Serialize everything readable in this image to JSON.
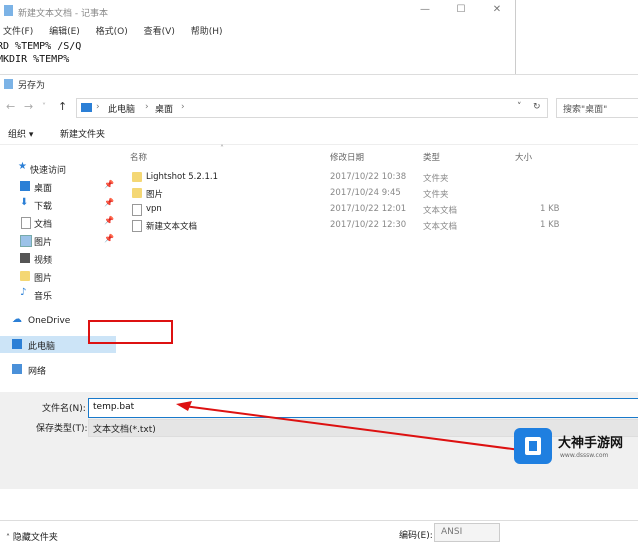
{
  "notepad": {
    "title": "新建文本文档 - 记事本",
    "menu": [
      "文件(F)",
      "编辑(E)",
      "格式(O)",
      "查看(V)",
      "帮助(H)"
    ],
    "lines": [
      "RD %TEMP% /S/Q",
      "MKDIR %TEMP%"
    ]
  },
  "dialog": {
    "title": "另存为",
    "breadcrumb": [
      "此电脑",
      "桌面"
    ],
    "search_placeholder": "搜索\"桌面\"",
    "toolbar": {
      "organize": "组织 ▾",
      "new_folder": "新建文件夹"
    },
    "nav": [
      {
        "label": "快速访问",
        "icon": "star-icon"
      },
      {
        "label": "桌面",
        "icon": "desktop-icon",
        "pinned": true
      },
      {
        "label": "下载",
        "icon": "download-icon",
        "pinned": true
      },
      {
        "label": "文档",
        "icon": "document-icon",
        "pinned": true
      },
      {
        "label": "图片",
        "icon": "picture-icon",
        "pinned": true
      },
      {
        "label": "视频",
        "icon": "video-icon"
      },
      {
        "label": "图片",
        "icon": "folder-icon"
      },
      {
        "label": "音乐",
        "icon": "music-icon"
      },
      {
        "label": "OneDrive",
        "icon": "cloud-icon"
      },
      {
        "label": "此电脑",
        "icon": "computer-icon",
        "selected": true
      },
      {
        "label": "网络",
        "icon": "network-icon"
      }
    ],
    "columns": [
      "名称",
      "修改日期",
      "类型",
      "大小"
    ],
    "files": [
      {
        "name": "Lightshot 5.2.1.1",
        "date": "2017/10/22 10:38",
        "type": "文件夹",
        "size": "",
        "kind": "folder"
      },
      {
        "name": "图片",
        "date": "2017/10/24 9:45",
        "type": "文件夹",
        "size": "",
        "kind": "folder"
      },
      {
        "name": "vpn",
        "date": "2017/10/22 12:01",
        "type": "文本文档",
        "size": "1 KB",
        "kind": "doc"
      },
      {
        "name": "新建文本文档",
        "date": "2017/10/22 12:30",
        "type": "文本文档",
        "size": "1 KB",
        "kind": "doc"
      }
    ],
    "filename_label": "文件名(N):",
    "filename_value": "temp.bat",
    "filetype_label": "保存类型(T):",
    "filetype_value": "文本文档(*.txt)",
    "hide_folders": "隐藏文件夹",
    "encoding_label": "编码(E):",
    "encoding_value": "ANSI"
  },
  "watermark": {
    "text": "大神手游网",
    "sub": "www.dsssw.com"
  }
}
